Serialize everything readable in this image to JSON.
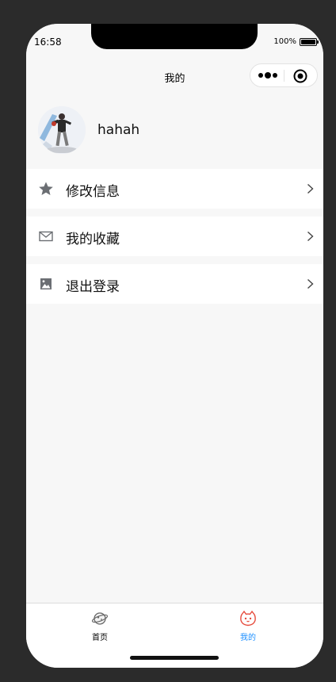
{
  "status_bar": {
    "time": "16:58",
    "battery_text": "100%"
  },
  "nav": {
    "title": "我的",
    "more_icon": "more-dots-icon",
    "close_icon": "target-circle-icon"
  },
  "profile": {
    "username": "hahah",
    "avatar_icon": "user-photo"
  },
  "menu": [
    {
      "label": "修改信息",
      "icon": "star-icon"
    },
    {
      "label": "我的收藏",
      "icon": "mail-icon"
    },
    {
      "label": "退出登录",
      "icon": "image-icon"
    }
  ],
  "tab_bar": {
    "tabs": [
      {
        "label": "首页",
        "icon": "planet-icon",
        "active": false
      },
      {
        "label": "我的",
        "icon": "cat-face-icon",
        "active": true
      }
    ],
    "colors": {
      "inactive": "#000000",
      "active": "#1e90ff",
      "active_icon": "#e64a3b"
    }
  }
}
